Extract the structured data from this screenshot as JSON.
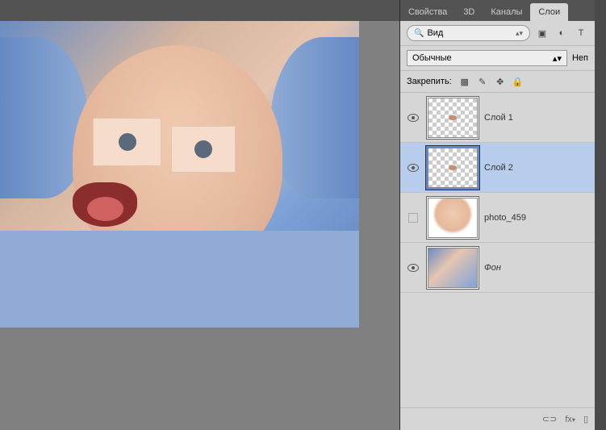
{
  "tabs": {
    "properties": "Свойства",
    "threeD": "3D",
    "channels": "Каналы",
    "layers": "Слои"
  },
  "filter": {
    "label": "Вид"
  },
  "blend": {
    "mode": "Обычные",
    "opacity_label": "Неп"
  },
  "lock": {
    "label": "Закрепить:"
  },
  "layers": [
    {
      "name": "Слой 1",
      "visible": true,
      "selected": false,
      "thumb": "checker-dot",
      "italic": false
    },
    {
      "name": "Слой 2",
      "visible": true,
      "selected": true,
      "thumb": "checker-dot",
      "italic": false
    },
    {
      "name": "photo_459",
      "visible": false,
      "selected": false,
      "thumb": "baby-white",
      "italic": false
    },
    {
      "name": "Фон",
      "visible": true,
      "selected": false,
      "thumb": "baby-hood",
      "italic": true
    }
  ],
  "footer": {
    "link": "⊂⊃",
    "fx": "fx"
  }
}
